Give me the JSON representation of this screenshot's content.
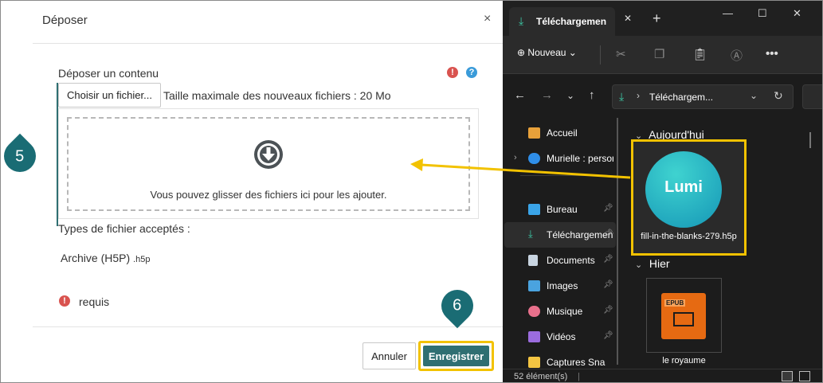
{
  "dialog": {
    "title": "Déposer",
    "close_glyph": "×",
    "upload_label": "Déposer un contenu",
    "choose_file": "Choisir un fichier...",
    "max_size": "Taille maximale des nouveaux fichiers : 20 Mo",
    "drop_text": "Vous pouvez glisser des fichiers ici pour les ajouter.",
    "accepted_types_label": "Types de fichier acceptés :",
    "archive_type": "Archive (H5P)",
    "archive_ext": ".h5p",
    "required_text": "requis",
    "cancel": "Annuler",
    "save": "Enregistrer"
  },
  "callouts": {
    "first": "5",
    "second": "6"
  },
  "explorer": {
    "tab_label": "Téléchargements",
    "new_button": "Nouveau",
    "address": "Téléchargem...",
    "sidebar": [
      {
        "label": "Accueil",
        "icon": "home-icon",
        "color": "#e8a13a"
      },
      {
        "label": "Murielle : personnel",
        "icon": "cloud-icon",
        "color": "#2f8ee8"
      },
      {
        "label": "Bureau",
        "icon": "desktop-icon",
        "color": "#3aa4e8"
      },
      {
        "label": "Téléchargements",
        "icon": "download-icon",
        "color": "#3dc9a6"
      },
      {
        "label": "Documents",
        "icon": "document-icon",
        "color": "#c8d4e0"
      },
      {
        "label": "Images",
        "icon": "image-icon",
        "color": "#4aa3df"
      },
      {
        "label": "Musique",
        "icon": "music-icon",
        "color": "#e8708c"
      },
      {
        "label": "Vidéos",
        "icon": "video-icon",
        "color": "#9b6cde"
      },
      {
        "label": "Captures Sna",
        "icon": "folder-icon",
        "color": "#f4c542"
      }
    ],
    "group_today": "Aujourd'hui",
    "group_yesterday": "Hier",
    "lumi_logo_text": "Lumi",
    "file_today": "fill-in-the-blanks-279.h5p",
    "epub_label": "EPUB",
    "file_yesterday": "le royaume",
    "status": "52 élément(s)"
  },
  "colors": {
    "accent": "#2f6f72",
    "highlight": "#f2c200",
    "required": "#d9534f",
    "help": "#3a9bd9"
  }
}
